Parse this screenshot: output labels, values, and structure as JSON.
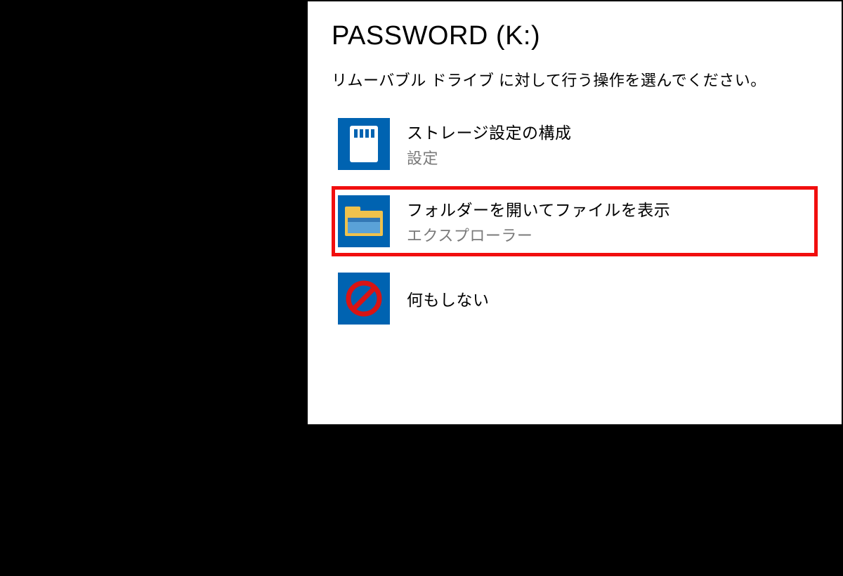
{
  "panel": {
    "title": "PASSWORD (K:)",
    "subtitle": "リムーバブル ドライブ に対して行う操作を選んでください。"
  },
  "options": [
    {
      "label": "ストレージ設定の構成",
      "sublabel": "設定",
      "icon": "sd-card-icon",
      "highlighted": false
    },
    {
      "label": "フォルダーを開いてファイルを表示",
      "sublabel": "エクスプローラー",
      "icon": "folder-explorer-icon",
      "highlighted": true
    },
    {
      "label": "何もしない",
      "sublabel": "",
      "icon": "no-action-icon",
      "highlighted": false
    }
  ],
  "colors": {
    "icon_bg": "#0063b1",
    "highlight": "#f10e0e"
  }
}
